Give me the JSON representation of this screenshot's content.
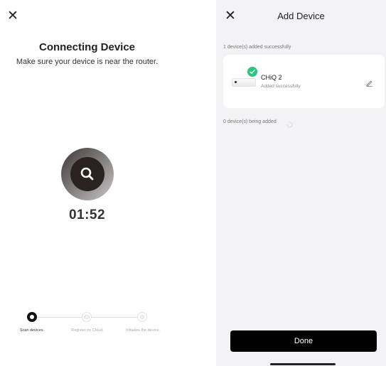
{
  "connecting": {
    "close_icon": "close-icon",
    "title": "Connecting Device",
    "subtitle": "Make sure your device is near the router.",
    "timer": "01:52",
    "search_icon": "magnifier-icon",
    "steps": [
      {
        "label": "Scan devices.",
        "state": "active"
      },
      {
        "label": "Register on Cloud.",
        "state": "pending",
        "icon": "cloud-icon"
      },
      {
        "label": "Initialize the device.",
        "state": "pending",
        "icon": "gear-icon"
      }
    ]
  },
  "add_device": {
    "close_icon": "close-icon",
    "title": "Add Device",
    "added_count_text": "1 device(s) added successfully",
    "device": {
      "name": "CHiQ 2",
      "status": "Added successfully",
      "status_color": "#2dc47e",
      "edit_icon": "pencil-icon"
    },
    "adding_count_text": "0 device(s) being added",
    "done_label": "Done"
  }
}
